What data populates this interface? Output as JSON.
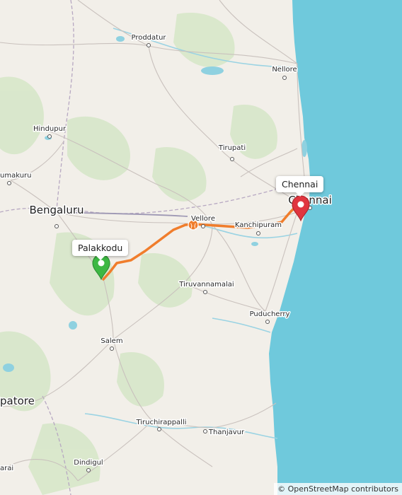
{
  "map": {
    "places": [
      {
        "id": "proddatur",
        "name": "Proddatur",
        "size": "small"
      },
      {
        "id": "nellore",
        "name": "Nellore",
        "size": "small"
      },
      {
        "id": "hindupur",
        "name": "Hindupur",
        "size": "small"
      },
      {
        "id": "tirupati",
        "name": "Tirupati",
        "size": "small"
      },
      {
        "id": "tumakuru",
        "name": "umakuru",
        "size": "small"
      },
      {
        "id": "bengaluru",
        "name": "Bengaluru",
        "size": "big"
      },
      {
        "id": "chennai",
        "name": "Chennai",
        "size": "big"
      },
      {
        "id": "vellore",
        "name": "Vellore",
        "size": "small"
      },
      {
        "id": "kanchipuram",
        "name": "Kanchipuram",
        "size": "small"
      },
      {
        "id": "tiruvannamalai",
        "name": "Tiruvannamalai",
        "size": "small"
      },
      {
        "id": "puducherry",
        "name": "Puducherry",
        "size": "small"
      },
      {
        "id": "salem",
        "name": "Salem",
        "size": "small"
      },
      {
        "id": "coimbatore",
        "name": "patore",
        "size": "big"
      },
      {
        "id": "tiruchirappalli",
        "name": "Tiruchirappalli",
        "size": "small"
      },
      {
        "id": "thanjavur",
        "name": "Thanjavur",
        "size": "small"
      },
      {
        "id": "dindigul",
        "name": "Dindigul",
        "size": "small"
      },
      {
        "id": "arai",
        "name": "arai",
        "size": "small"
      }
    ],
    "route": {
      "color": "#f07d2c",
      "start": {
        "label": "Palakkodu",
        "marker_color": "#3db843"
      },
      "end": {
        "label": "Chennai",
        "marker_color": "#e0353f"
      }
    },
    "sea_color": "#6fc9dc",
    "land_color": "#f2efe9",
    "attribution": "© OpenStreetMap contributors"
  }
}
